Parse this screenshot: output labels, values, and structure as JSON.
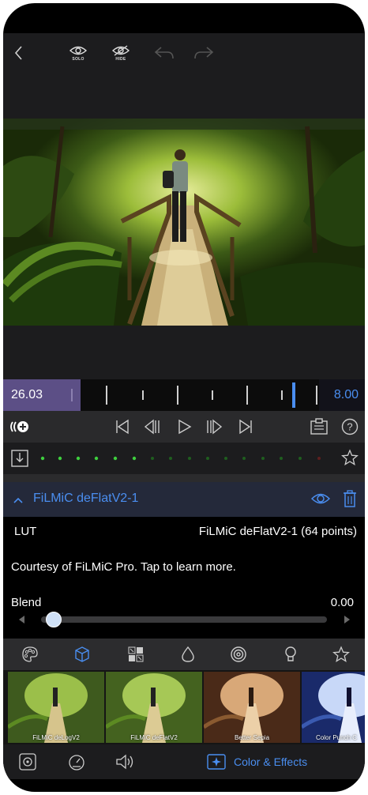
{
  "toolbar": {
    "solo_label": "SOLO",
    "hide_label": "HIDE"
  },
  "timeline": {
    "start_time": "26.03",
    "end_time": "8.00"
  },
  "layer": {
    "title": "FiLMiC deFlatV2-1"
  },
  "lut": {
    "label": "LUT",
    "value": "FiLMiC deFlatV2-1 (64 points)",
    "courtesy": "Courtesy of FiLMiC Pro. Tap to learn more."
  },
  "blend": {
    "label": "Blend",
    "value": "0.00",
    "level": 0.0
  },
  "thumbnails": [
    {
      "label": "FiLMiC deLogV2"
    },
    {
      "label": "FiLMiC deFlatV2"
    },
    {
      "label": "Better Sepia"
    },
    {
      "label": "Color Punch C"
    }
  ],
  "bottom": {
    "color_effects_label": "Color & Effects"
  },
  "colors": {
    "accent": "#4a8ef0",
    "timeline_start_bg": "#5c4f86"
  },
  "icons": [
    "back-icon",
    "eye-solo-icon",
    "eye-hide-icon",
    "undo-icon",
    "redo-icon",
    "loop-add-icon",
    "skip-start-icon",
    "step-back-icon",
    "play-icon",
    "step-forward-icon",
    "skip-end-icon",
    "clipboard-icon",
    "help-icon",
    "import-icon",
    "star-icon",
    "chevron-up-icon",
    "eye-icon",
    "trash-icon",
    "palette-icon",
    "cube-icon",
    "grid-icon",
    "drop-icon",
    "spiral-icon",
    "bulb-icon",
    "target-icon",
    "speedometer-icon",
    "speaker-icon",
    "effects-icon"
  ]
}
